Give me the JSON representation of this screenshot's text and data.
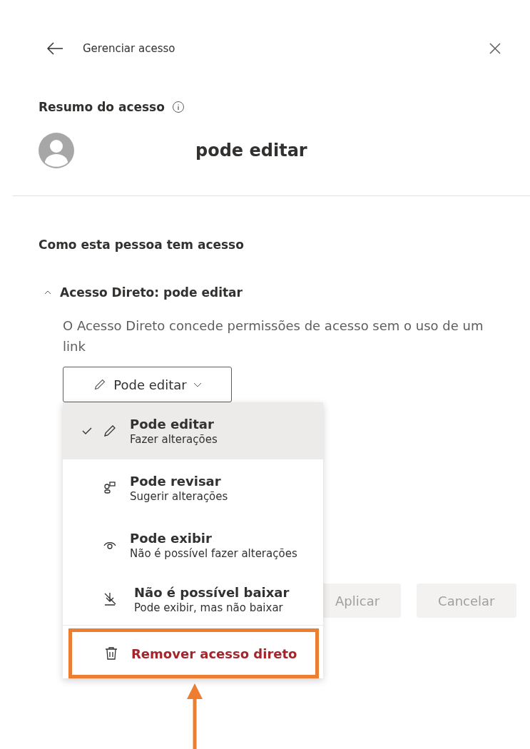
{
  "header": {
    "title": "Gerenciar acesso"
  },
  "summary": {
    "title": "Resumo do acesso",
    "permission": "pode editar"
  },
  "access": {
    "title": "Como esta pessoa tem acesso",
    "section": {
      "title": "Acesso Direto: pode editar",
      "expanded": true,
      "description": "O Acesso Direto concede permissões de acesso sem o uso de um link"
    },
    "dropdown": {
      "label": "Pode editar",
      "expanded": true
    },
    "menu": [
      {
        "kind": "edit",
        "title": "Pode editar",
        "subtitle": "Fazer alterações",
        "selected": true
      },
      {
        "kind": "review",
        "title": "Pode revisar",
        "subtitle": "Sugerir alterações",
        "selected": false
      },
      {
        "kind": "view",
        "title": "Pode exibir",
        "subtitle": "Não é possível fazer alterações",
        "selected": false
      },
      {
        "kind": "nodownload",
        "title": "Não é possível baixar",
        "subtitle": "Pode exibir, mas não baixar",
        "selected": false
      },
      {
        "kind": "remove",
        "title": "Remover acesso direto",
        "highlighted": true
      }
    ]
  },
  "buttons": [
    {
      "label": "Aplicar",
      "disabled": true
    },
    {
      "label": "Cancelar",
      "disabled": true
    }
  ]
}
